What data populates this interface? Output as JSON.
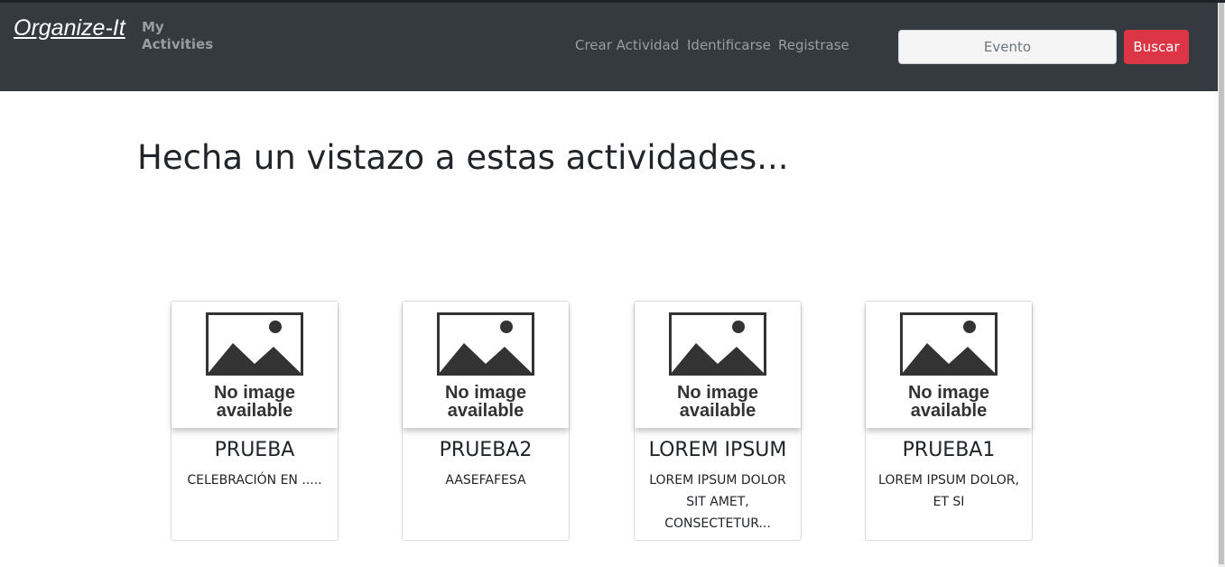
{
  "navbar": {
    "brand": "Organize-It",
    "my_activities": "My Activities",
    "links": [
      "Crear Actividad",
      "Identificarse",
      "Registrase"
    ],
    "search_placeholder": "Evento",
    "search_button": "Buscar"
  },
  "main": {
    "heading": "Hecha un vistazo a estas actividades..."
  },
  "cards": [
    {
      "image_line1": "No image",
      "image_line2": "available",
      "title": "PRUEBA",
      "text": "CELEBRACIÓN EN ....."
    },
    {
      "image_line1": "No image",
      "image_line2": "available",
      "title": "PRUEBA2",
      "text": "AASEFAFESA"
    },
    {
      "image_line1": "No image",
      "image_line2": "available",
      "title": "LOREM IPSUM",
      "text": "LOREM IPSUM DOLOR SIT AMET, CONSECTETUR..."
    },
    {
      "image_line1": "No image",
      "image_line2": "available",
      "title": "PRUEBA1",
      "text": "LOREM IPSUM DOLOR, ET SI"
    }
  ],
  "colors": {
    "navbar_bg": "#343a40",
    "danger": "#dc3545"
  }
}
